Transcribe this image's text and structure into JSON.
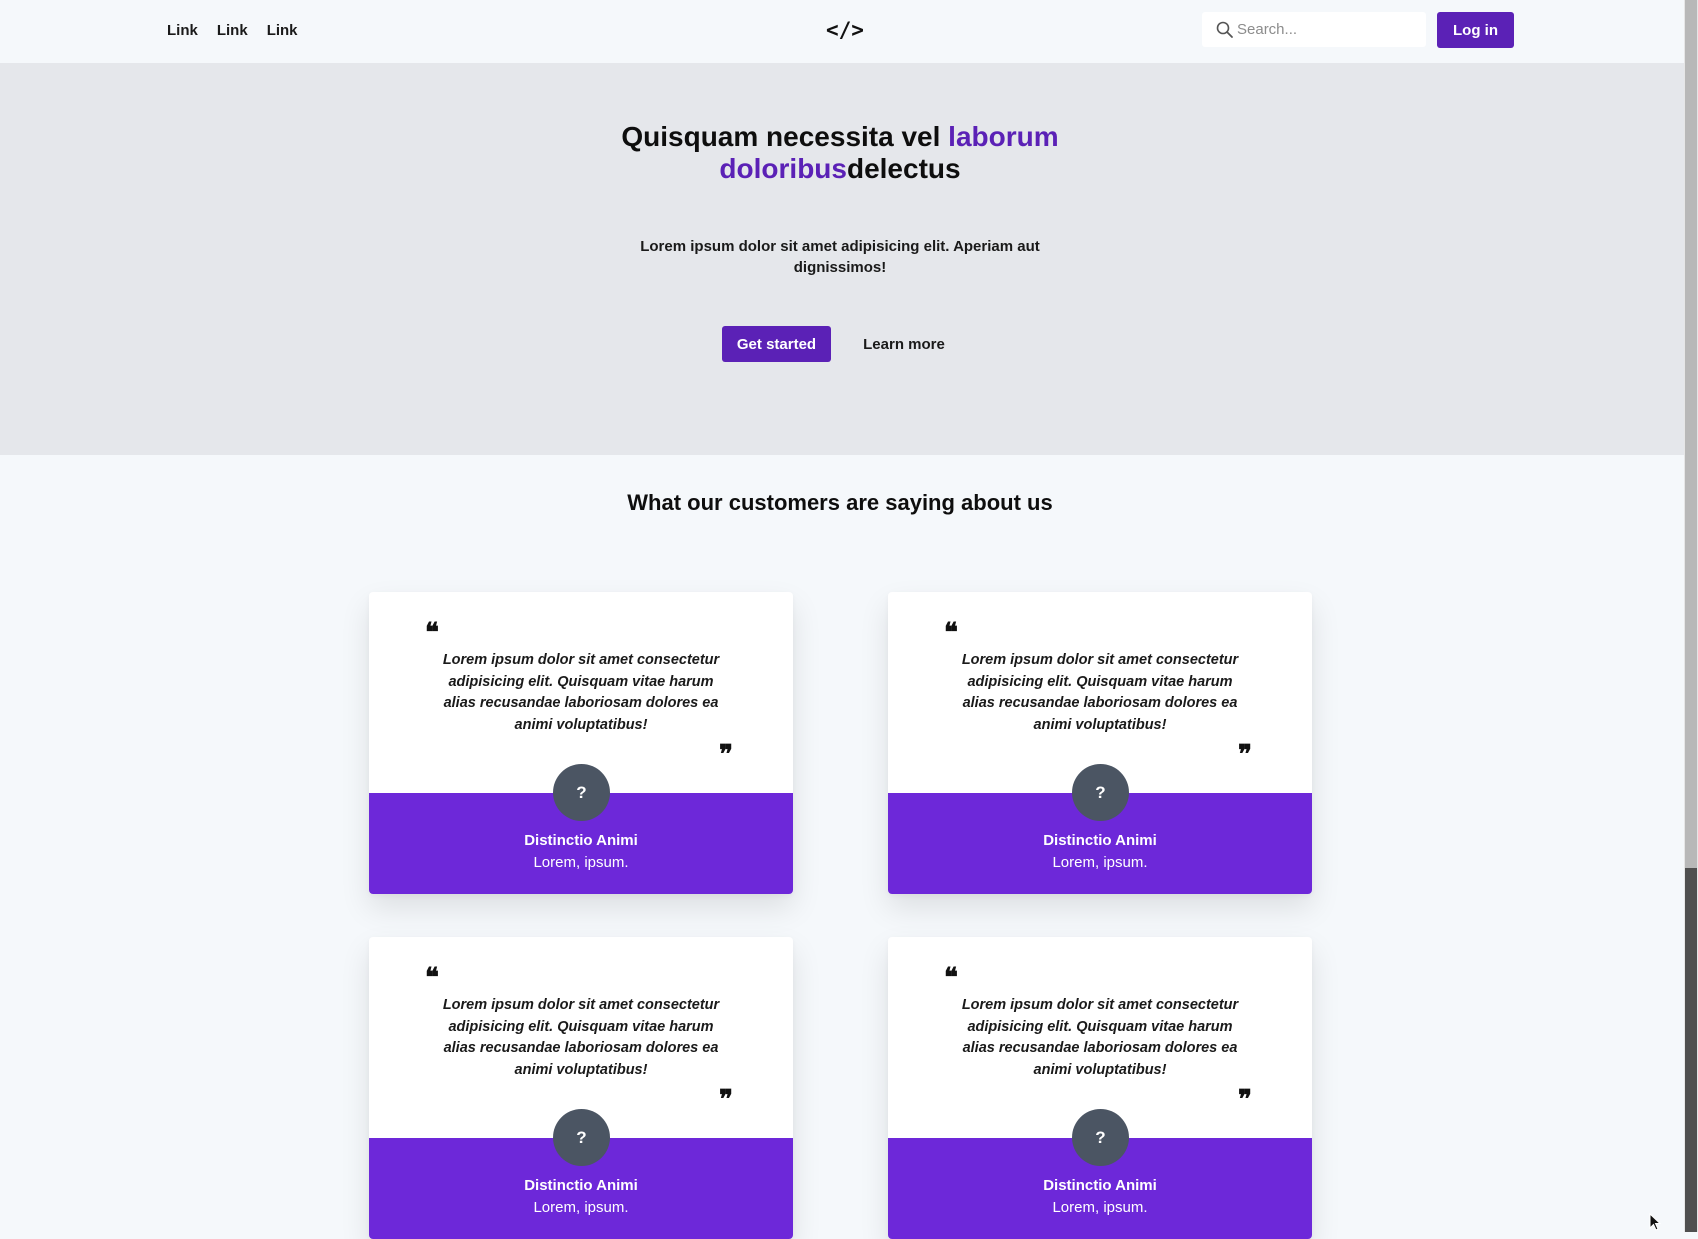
{
  "header": {
    "links": [
      "Link",
      "Link",
      "Link"
    ],
    "logo": "</>",
    "search_placeholder": "Search...",
    "login_label": "Log in"
  },
  "hero": {
    "title_part1": "Quisquam necessita vel ",
    "title_highlight1": "laborum",
    "title_highlight2": "doloribus",
    "title_part2": "delectus",
    "subtitle": "Lorem ipsum dolor sit amet adipisicing elit. Aperiam aut dignissimos!",
    "primary_cta": "Get started",
    "secondary_cta": "Learn more"
  },
  "testimonials": {
    "heading": "What our customers are saying about us",
    "cards": [
      {
        "quote": "Lorem ipsum dolor sit amet consectetur adipisicing elit. Quisquam vitae harum alias recusandae laboriosam dolores ea animi voluptatibus!",
        "avatar": "?",
        "name": "Distinctio Animi",
        "role": "Lorem, ipsum."
      },
      {
        "quote": "Lorem ipsum dolor sit amet consectetur adipisicing elit. Quisquam vitae harum alias recusandae laboriosam dolores ea animi voluptatibus!",
        "avatar": "?",
        "name": "Distinctio Animi",
        "role": "Lorem, ipsum."
      },
      {
        "quote": "Lorem ipsum dolor sit amet consectetur adipisicing elit. Quisquam vitae harum alias recusandae laboriosam dolores ea animi voluptatibus!",
        "avatar": "?",
        "name": "Distinctio Animi",
        "role": "Lorem, ipsum."
      },
      {
        "quote": "Lorem ipsum dolor sit amet consectetur adipisicing elit. Quisquam vitae harum alias recusandae laboriosam dolores ea animi voluptatibus!",
        "avatar": "?",
        "name": "Distinctio Animi",
        "role": "Lorem, ipsum."
      }
    ],
    "quote_open_glyph": "❝",
    "quote_close_glyph": "❞"
  },
  "colors": {
    "brand": "#5b21b6",
    "card_band": "#6d28d9",
    "hero_bg": "#e5e7eb",
    "avatar_bg": "#4b5563"
  },
  "icons": {
    "search": "search-icon",
    "cursor": "mouse-pointer-icon"
  }
}
